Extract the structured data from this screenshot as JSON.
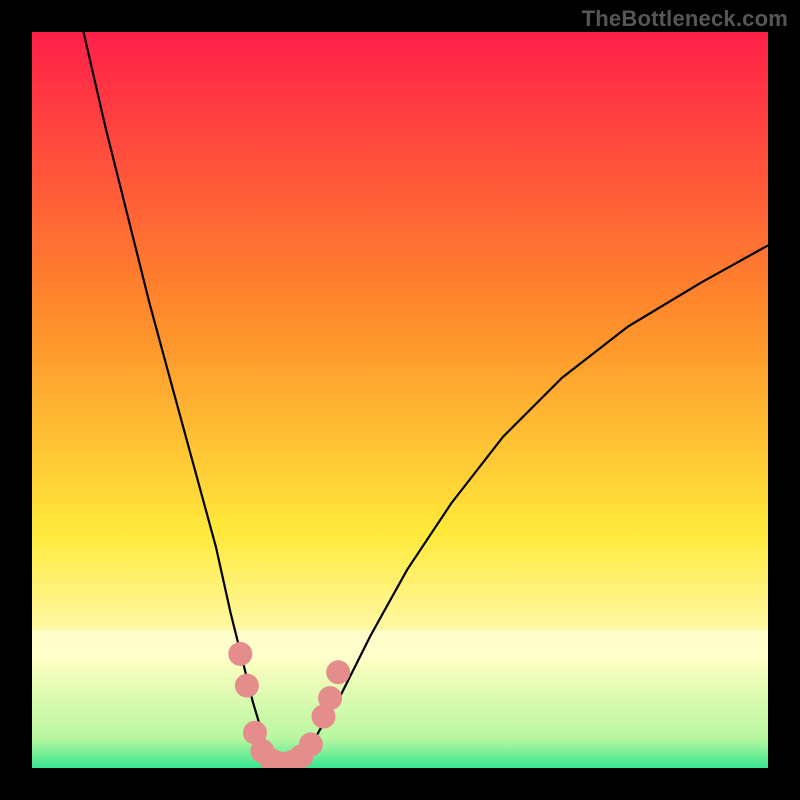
{
  "watermark": "TheBottleneck.com",
  "chart_data": {
    "type": "line",
    "title": "",
    "xlabel": "",
    "ylabel": "",
    "xlim": [
      0,
      100
    ],
    "ylim": [
      0,
      100
    ],
    "grid": false,
    "legend": false,
    "background_gradient": {
      "top_color": "#ff1f4a",
      "mid_color_1": "#ff8a2b",
      "mid_color_2": "#ffe93a",
      "band_color": "#fffec2",
      "bottom_color": "#38e690"
    },
    "series": [
      {
        "name": "bottleneck-curve",
        "x": [
          7,
          10,
          13,
          16,
          19,
          22,
          25,
          27,
          28.5,
          30,
          31.5,
          33,
          34.5,
          36,
          37.5,
          39,
          42,
          46,
          51,
          57,
          64,
          72,
          81,
          91,
          100
        ],
        "y": [
          100,
          87,
          75,
          63,
          52,
          41,
          30,
          21,
          15,
          9,
          4,
          1,
          0,
          0.5,
          2,
          5,
          10,
          18,
          27,
          36,
          45,
          53,
          60,
          66,
          71
        ]
      }
    ],
    "markers": {
      "name": "highlighted-points",
      "color": "#e58c8c",
      "points": [
        {
          "x": 28.3,
          "y": 15.5
        },
        {
          "x": 29.2,
          "y": 11.2
        },
        {
          "x": 30.3,
          "y": 4.8
        },
        {
          "x": 31.3,
          "y": 2.3
        },
        {
          "x": 32.6,
          "y": 1.0
        },
        {
          "x": 34.0,
          "y": 0.6
        },
        {
          "x": 35.3,
          "y": 0.8
        },
        {
          "x": 36.6,
          "y": 1.6
        },
        {
          "x": 37.9,
          "y": 3.2
        },
        {
          "x": 39.6,
          "y": 7.0
        },
        {
          "x": 40.5,
          "y": 9.5
        },
        {
          "x": 41.6,
          "y": 13.0
        }
      ]
    }
  }
}
